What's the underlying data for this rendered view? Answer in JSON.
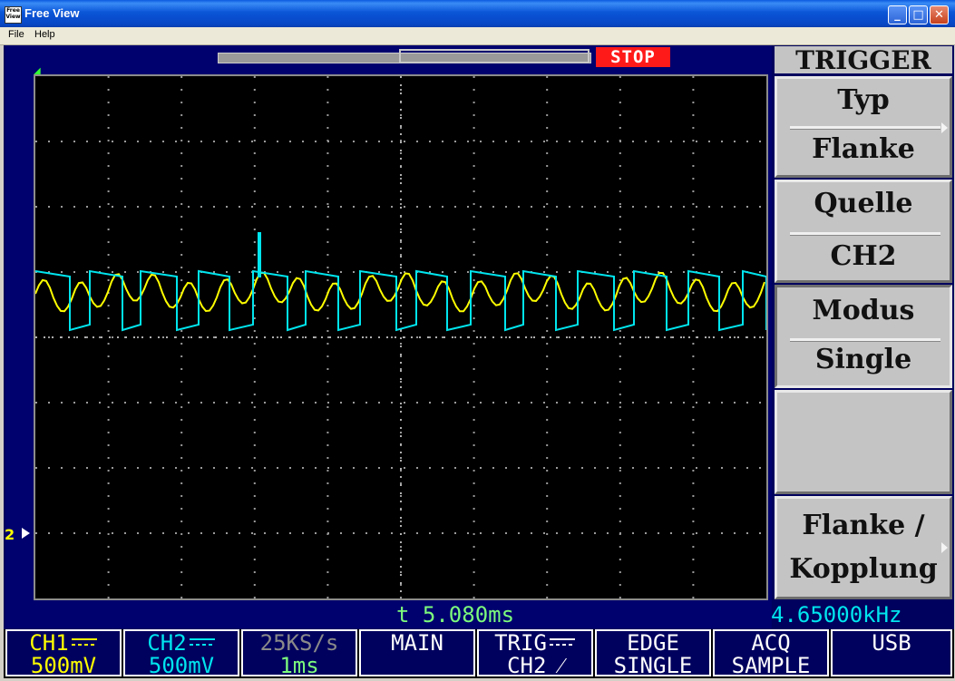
{
  "window": {
    "title": "Free View",
    "icon_text": "Free View",
    "buttons": [
      "_",
      "□",
      "✕"
    ]
  },
  "menubar": {
    "items": [
      "File",
      "Help"
    ]
  },
  "scope": {
    "run_state": "STOP",
    "time_readout": "t 5.080ms",
    "freq_readout": "4.65000kHz",
    "ground_marker": "2"
  },
  "side_menu": {
    "title": "TRIGGER",
    "boxes": [
      {
        "line1": "Typ",
        "line2": "Flanke"
      },
      {
        "line1": "Quelle",
        "line2": "CH2"
      },
      {
        "line1": "Modus",
        "line2": "Single"
      },
      {
        "line1": "",
        "line2": ""
      },
      {
        "line1": "Flanke /",
        "line2": "Kopplung"
      }
    ]
  },
  "status_bar": {
    "ch1": {
      "label": "CH1",
      "value": "500mV"
    },
    "ch2": {
      "label": "CH2",
      "value": "500mV"
    },
    "sample": {
      "label": "25KS/s",
      "value": "1ms"
    },
    "main": {
      "label": "MAIN"
    },
    "trig": {
      "label": "TRIG",
      "value": "CH2 ⁄"
    },
    "edge": {
      "label": "EDGE",
      "value": "SINGLE"
    },
    "acq": {
      "label": "ACQ",
      "value": "SAMPLE"
    },
    "usb": {
      "label": "USB"
    }
  },
  "colors": {
    "ch1": "#ffff00",
    "ch2": "#00e5ee",
    "readout": "#7cfc7c",
    "background": "#00005e",
    "stop": "#ff1a1a"
  }
}
